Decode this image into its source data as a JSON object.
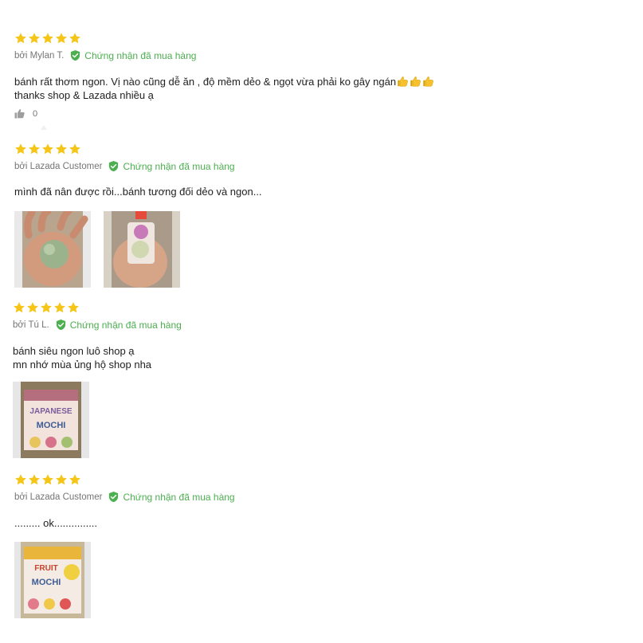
{
  "reviews": [
    {
      "rating": 5,
      "author": "bởi Mylan T.",
      "verified": "Chứng nhận đã mua hàng",
      "lines": [
        "bánh rất thơm ngon. Vị nào cũng dễ ăn , độ mềm dẻo & ngọt vừa phải ko gây ngán",
        "thanks shop & Lazada nhiều ạ"
      ],
      "emoji": [
        "thumbs-up-emoji",
        "thumbs-up-emoji",
        "thumbs-up-emoji"
      ],
      "likes": "0"
    },
    {
      "rating": 5,
      "author": "bởi Lazada Customer",
      "verified": "Chứng nhận đã mua hàng",
      "lines": [
        "mình đã nân được rồi...bánh tương đối dẻo và ngon..."
      ],
      "images": [
        "photo-mochi-in-hand",
        "photo-mochi-package-in-hand"
      ]
    },
    {
      "rating": 5,
      "author": "bởi Tú L.",
      "verified": "Chứng nhận đã mua hàng",
      "lines": [
        "bánh siêu ngon luô shop ạ",
        "mn nhớ mùa ủng hộ shop nha"
      ],
      "images": [
        "photo-japanese-mochi-box"
      ],
      "image_text": [
        "JAPANESE",
        "MOCHI"
      ]
    },
    {
      "rating": 5,
      "author": "bởi Lazada Customer",
      "verified": "Chứng nhận đã mua hàng",
      "lines": [
        "......... ok..............."
      ],
      "images": [
        "photo-fruit-mochi-box"
      ],
      "image_text": [
        "FRUIT",
        "MOCHI"
      ]
    }
  ],
  "colors": {
    "star": "#f5c518",
    "verified": "#4caf50",
    "meta": "#757575",
    "text": "#212121"
  }
}
